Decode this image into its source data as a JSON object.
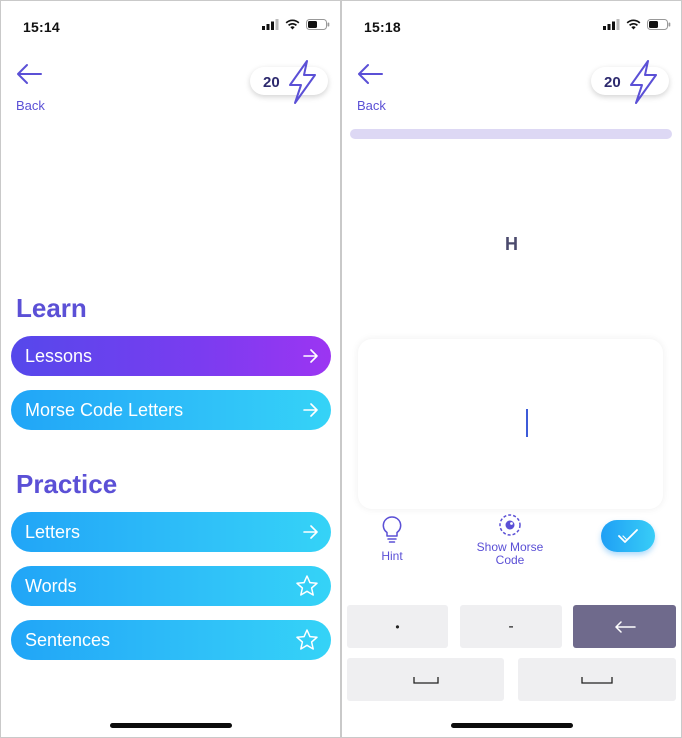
{
  "left_screen": {
    "status": {
      "time": "15:14"
    },
    "back_label": "Back",
    "energy": "20",
    "learn": {
      "title": "Learn",
      "items": [
        {
          "label": "Lessons",
          "icon": "arrow-right-icon"
        },
        {
          "label": "Morse Code Letters",
          "icon": "arrow-right-icon"
        }
      ]
    },
    "practice": {
      "title": "Practice",
      "items": [
        {
          "label": "Letters",
          "icon": "arrow-right-icon"
        },
        {
          "label": "Words",
          "icon": "star-icon"
        },
        {
          "label": "Sentences",
          "icon": "star-icon"
        }
      ]
    }
  },
  "right_screen": {
    "status": {
      "time": "15:18"
    },
    "back_label": "Back",
    "energy": "20",
    "progress": 0,
    "prompt_letter": "H",
    "answer": {
      "value": "",
      "placeholder": ""
    },
    "hint_label": "Hint",
    "show_morse_label_1": "Show Morse",
    "show_morse_label_2": "Code",
    "keyboard": {
      "dot": "•",
      "dash": "-",
      "letter_space": "⎵",
      "word_space": "⎵"
    }
  },
  "colors": {
    "accent": "#5b50d6",
    "gradient_purple": "#7b3cf0",
    "gradient_blue": "#2fc0f8",
    "progress_track": "#ddd8f4",
    "backspace_key": "#6f6a8c"
  }
}
